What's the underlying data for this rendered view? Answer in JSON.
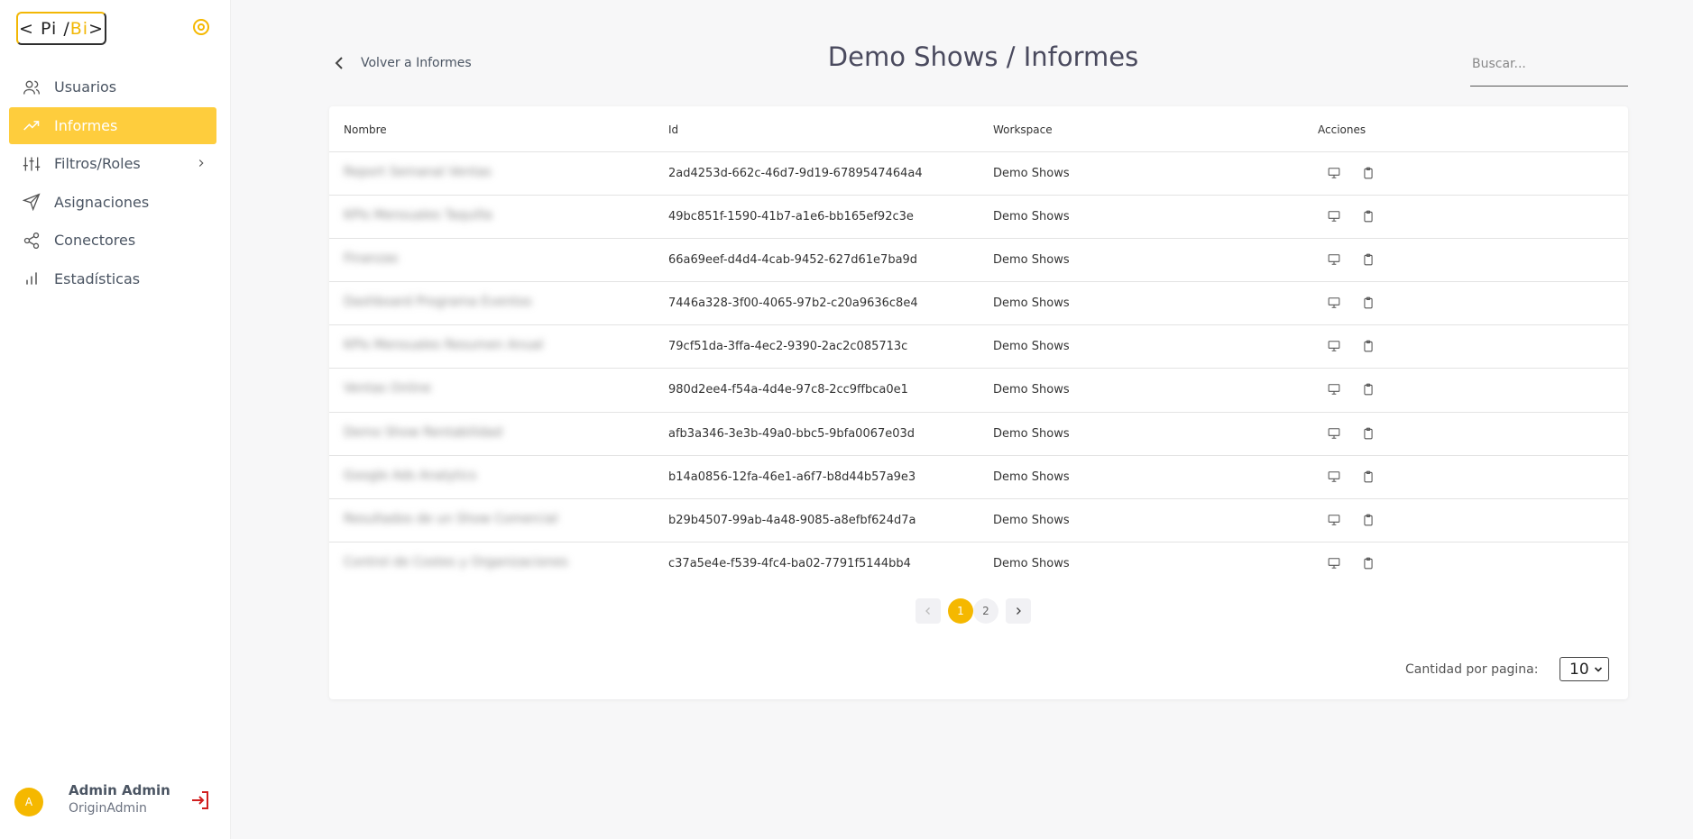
{
  "sidebar": {
    "logo": {
      "left": "< Pi / ",
      "bi": "Bi",
      "right": " >"
    },
    "items": [
      {
        "label": "Usuarios",
        "icon": "users-icon",
        "active": false
      },
      {
        "label": "Informes",
        "icon": "trending-up-icon",
        "active": true
      },
      {
        "label": "Filtros/Roles",
        "icon": "sliders-icon",
        "active": false,
        "has_chevron": true
      },
      {
        "label": "Asignaciones",
        "icon": "send-icon",
        "active": false
      },
      {
        "label": "Conectores",
        "icon": "share-icon",
        "active": false
      },
      {
        "label": "Estadísticas",
        "icon": "bar-chart-icon",
        "active": false
      }
    ],
    "user": {
      "initial": "A",
      "name": "Admin Admin",
      "role": "OriginAdmin"
    }
  },
  "header": {
    "back_label": "Volver a Informes",
    "title": "Demo Shows / Informes",
    "search_placeholder": "Buscar..."
  },
  "table": {
    "columns": [
      "Nombre",
      "Id",
      "Workspace",
      "Acciones"
    ],
    "rows": [
      {
        "name": "Report Semanal Ventas",
        "id": "2ad4253d-662c-46d7-9d19-6789547464a4",
        "workspace": "Demo Shows"
      },
      {
        "name": "KPIs Mensuales Taquilla",
        "id": "49bc851f-1590-41b7-a1e6-bb165ef92c3e",
        "workspace": "Demo Shows"
      },
      {
        "name": "Finanzas",
        "id": "66a69eef-d4d4-4cab-9452-627d61e7ba9d",
        "workspace": "Demo Shows"
      },
      {
        "name": "Dashboard Programa Eventos",
        "id": "7446a328-3f00-4065-97b2-c20a9636c8e4",
        "workspace": "Demo Shows"
      },
      {
        "name": "KPIs Mensuales Resumen Anual",
        "id": "79cf51da-3ffa-4ec2-9390-2ac2c085713c",
        "workspace": "Demo Shows"
      },
      {
        "name": "Ventas Online",
        "id": "980d2ee4-f54a-4d4e-97c8-2cc9ffbca0e1",
        "workspace": "Demo Shows"
      },
      {
        "name": "Demo Show Rentabilidad",
        "id": "afb3a346-3e3b-49a0-bbc5-9bfa0067e03d",
        "workspace": "Demo Shows"
      },
      {
        "name": "Google Ads Analytics",
        "id": "b14a0856-12fa-46e1-a6f7-b8d44b57a9e3",
        "workspace": "Demo Shows"
      },
      {
        "name": "Resultados de un Show Comercial",
        "id": "b29b4507-99ab-4a48-9085-a8efbf624d7a",
        "workspace": "Demo Shows"
      },
      {
        "name": "Control de Costes y Organizaciones",
        "id": "c37a5e4e-f539-4fc4-ba02-7791f5144bb4",
        "workspace": "Demo Shows"
      }
    ]
  },
  "pagination": {
    "pages": [
      "1",
      "2"
    ],
    "current": "1",
    "per_page_label": "Cantidad por pagina:",
    "per_page_value": "10"
  },
  "colors": {
    "accent": "#f5b800",
    "active_nav": "#fecd3d",
    "logout": "#d11f1f"
  }
}
